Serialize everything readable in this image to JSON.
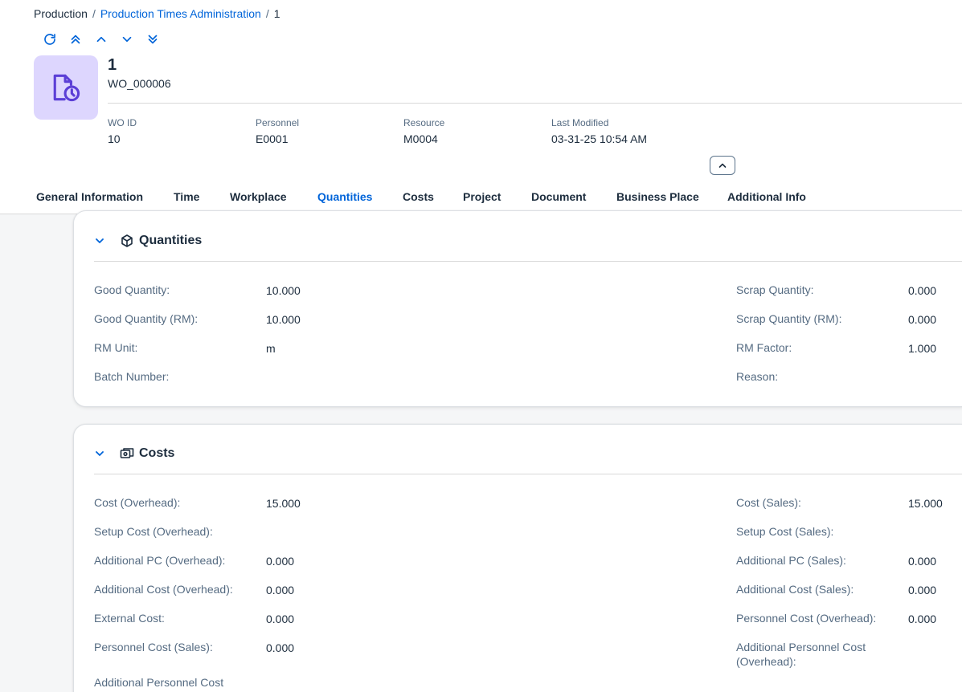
{
  "breadcrumb": {
    "root": "Production",
    "parent": "Production Times Administration",
    "current": "1",
    "separator": "/"
  },
  "toolbar": {
    "icons": [
      "refresh-icon",
      "first-record-icon",
      "previous-record-icon",
      "next-record-icon",
      "last-record-icon"
    ]
  },
  "header": {
    "title": "1",
    "subtitle": "WO_000006",
    "avatar_icon": "document-clock-icon",
    "kpis": [
      {
        "label": "WO ID",
        "value": "10"
      },
      {
        "label": "Personnel",
        "value": "E0001"
      },
      {
        "label": "Resource",
        "value": "M0004"
      },
      {
        "label": "Last Modified",
        "value": "03-31-25 10:54 AM"
      }
    ]
  },
  "tabs": [
    {
      "label": "General Information"
    },
    {
      "label": "Time"
    },
    {
      "label": "Workplace"
    },
    {
      "label": "Quantities",
      "active": true
    },
    {
      "label": "Costs"
    },
    {
      "label": "Project"
    },
    {
      "label": "Document"
    },
    {
      "label": "Business Place"
    },
    {
      "label": "Additional Info"
    }
  ],
  "quantities": {
    "title": "Quantities",
    "icon": "package-icon",
    "left": [
      {
        "label": "Good Quantity:",
        "value": "10.000"
      },
      {
        "label": "Good Quantity (RM):",
        "value": "10.000"
      },
      {
        "label": "RM Unit:",
        "value": "m"
      },
      {
        "label": "Batch Number:",
        "value": ""
      }
    ],
    "right": [
      {
        "label": "Scrap Quantity:",
        "value": "0.000"
      },
      {
        "label": "Scrap Quantity (RM):",
        "value": "0.000"
      },
      {
        "label": "RM Factor:",
        "value": "1.000"
      },
      {
        "label": "Reason:",
        "value": ""
      }
    ]
  },
  "costs": {
    "title": "Costs",
    "icon": "money-bills-icon",
    "left": [
      {
        "label": "Cost (Overhead):",
        "value": "15.000"
      },
      {
        "label": "Setup Cost (Overhead):",
        "value": ""
      },
      {
        "label": "Additional PC (Overhead):",
        "value": "0.000"
      },
      {
        "label": "Additional Cost (Overhead):",
        "value": "0.000"
      },
      {
        "label": "External Cost:",
        "value": "0.000"
      },
      {
        "label": "Personnel Cost (Sales):",
        "value": "0.000"
      },
      {
        "label": "Additional Personnel Cost",
        "value": ""
      }
    ],
    "right": [
      {
        "label": "Cost (Sales):",
        "value": "15.000"
      },
      {
        "label": "Setup Cost (Sales):",
        "value": ""
      },
      {
        "label": "Additional PC (Sales):",
        "value": "0.000"
      },
      {
        "label": "Additional Cost (Sales):",
        "value": "0.000"
      },
      {
        "label": "Personnel Cost (Overhead):",
        "value": "0.000"
      },
      {
        "label": "Additional Personnel Cost (Overhead):",
        "value": ""
      }
    ]
  },
  "colors": {
    "accent": "#0064d9",
    "avatar_bg": "#ddd6fe",
    "avatar_icon": "#5b3fd6",
    "label": "#556b82",
    "text": "#1d2d3e"
  }
}
